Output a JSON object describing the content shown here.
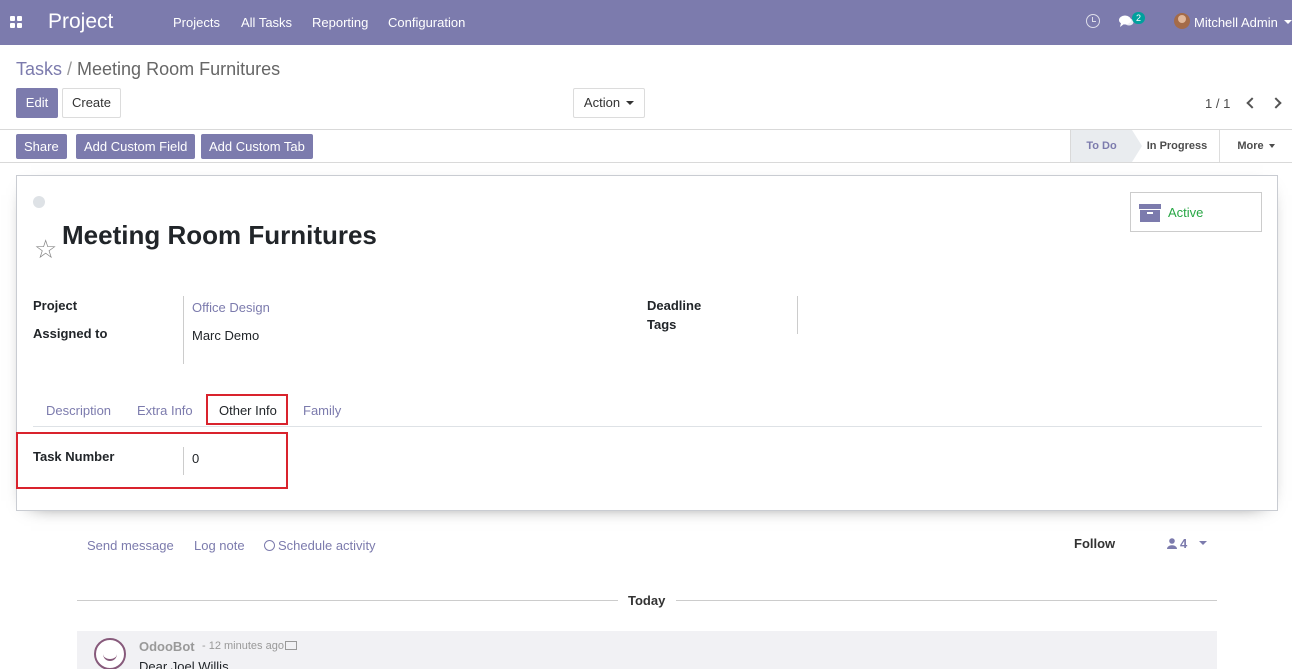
{
  "navbar": {
    "brand": "Project",
    "menu": [
      "Projects",
      "All Tasks",
      "Reporting",
      "Configuration"
    ],
    "chat_count": "2",
    "user": "Mitchell Admin"
  },
  "breadcrumb": {
    "parent": "Tasks",
    "separator": "/",
    "current": "Meeting Room Furnitures"
  },
  "buttons": {
    "edit": "Edit",
    "create": "Create",
    "action": "Action"
  },
  "pager": {
    "value": "1 / 1"
  },
  "statusbar": {
    "buttons": [
      "Share",
      "Add Custom Field",
      "Add Custom Tab"
    ],
    "stages": [
      "To Do",
      "In Progress",
      "More"
    ],
    "current_stage": "To Do"
  },
  "form": {
    "title": "Meeting Room Furnitures",
    "active_label": "Active",
    "fields_left": [
      {
        "label": "Project",
        "value": "Office Design"
      },
      {
        "label": "Assigned to",
        "value": "Marc Demo"
      }
    ],
    "fields_right": [
      {
        "label": "Deadline",
        "value": ""
      },
      {
        "label": "Tags",
        "value": ""
      }
    ],
    "tabs": [
      "Description",
      "Extra Info",
      "Other Info",
      "Family"
    ],
    "active_tab": "Other Info",
    "tab_fields": [
      {
        "label": "Task Number",
        "value": "0"
      }
    ]
  },
  "chatter": {
    "send_message": "Send message",
    "log_note": "Log note",
    "schedule_activity": "Schedule activity",
    "follow": "Follow",
    "followers_count": "4",
    "today": "Today",
    "message": {
      "author": "OdooBot",
      "time": "- 12 minutes ago",
      "text": "Dear Joel Willis,"
    }
  },
  "colors": {
    "brand": "#7c7bad",
    "active": "#28a745",
    "highlight": "#d9232d"
  }
}
